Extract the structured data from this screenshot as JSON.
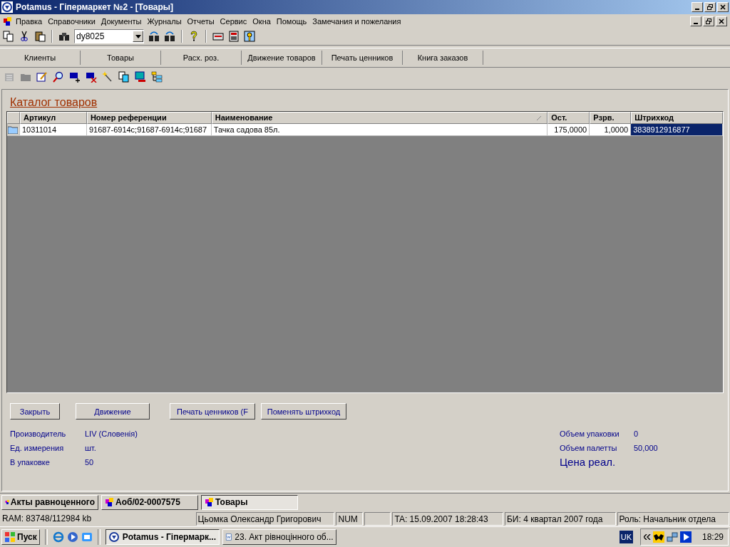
{
  "window": {
    "title": "Potamus - Гіпермаркет №2 - [Товары]"
  },
  "menu": [
    "Правка",
    "Справочники",
    "Документы",
    "Журналы",
    "Отчеты",
    "Сервис",
    "Окна",
    "Помощь",
    "Замечания и пожелания"
  ],
  "toolbar": {
    "search_value": "dy8025"
  },
  "nav_tabs": [
    "Клиенты",
    "Товары",
    "Расх. роз.",
    "Движение товаров",
    "Печать ценников",
    "Книга заказов"
  ],
  "catalog": {
    "title": "Каталог товаров",
    "columns": [
      {
        "label": "Артикул",
        "sorted": false
      },
      {
        "label": "Номер референции",
        "sorted": false
      },
      {
        "label": "Наименование",
        "sorted": true
      },
      {
        "label": "Ост.",
        "sorted": false
      },
      {
        "label": "Рзрв.",
        "sorted": false
      },
      {
        "label": "Штрихкод",
        "sorted": false
      }
    ],
    "rows": [
      {
        "cells": [
          {
            "text": "10311014",
            "selected": false
          },
          {
            "text": "91687-6914c;91687-6914c;91687",
            "selected": false
          },
          {
            "text": "Тачка садова 85л.",
            "selected": false
          },
          {
            "text": "175,0000",
            "selected": false
          },
          {
            "text": "1,0000",
            "selected": false
          },
          {
            "text": "3838912916877",
            "selected": true
          }
        ]
      }
    ]
  },
  "buttons": [
    "Закрыть",
    "Движение",
    "Печать  ценников (F",
    "Поменять штрихкод"
  ],
  "details_left": [
    {
      "label": "Производитель",
      "value": "LIV (Словенія)"
    },
    {
      "label": "Ед. измерения",
      "value": "шт."
    },
    {
      "label": "В упаковке",
      "value": "50"
    }
  ],
  "details_right": [
    {
      "label": "Объем упаковки",
      "value": "0"
    },
    {
      "label": "Объем палетты",
      "value": "50,000"
    }
  ],
  "price_label": "Цена реал.",
  "mdi_tabs": [
    {
      "label": "Акты равноценного",
      "selected": false
    },
    {
      "label": "Аоб/02-0007575",
      "selected": false
    },
    {
      "label": "Товары",
      "selected": true
    }
  ],
  "status_bar": [
    "RAM: 83748/112984 kb",
    "Цьомка Олександр Григорович",
    "NUM",
    "TA: 15.09.2007 18:28:43",
    "БИ: 4 квартал 2007 года",
    "Роль: Начальник отдела"
  ],
  "taskbar": {
    "start": "Пуск",
    "tasks": [
      {
        "label": "Potamus - Гіпермарк...",
        "selected": true
      },
      {
        "label": "23. Акт рівноцінного об...",
        "selected": false
      }
    ],
    "language": "UK",
    "clock": "18:29"
  }
}
